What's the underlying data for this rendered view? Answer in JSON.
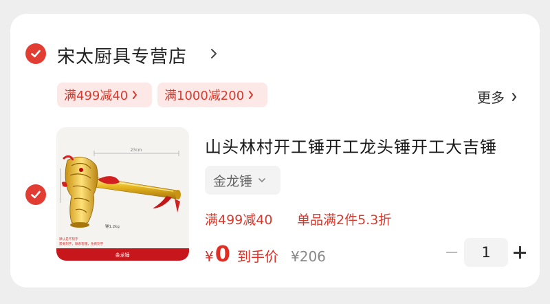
{
  "store": {
    "name": "宋太厨具专营店",
    "chevron_icon": "chevron-right-icon",
    "selected": true
  },
  "promos": [
    {
      "label": "满499减40"
    },
    {
      "label": "满1000减200"
    }
  ],
  "more_label": "更多",
  "item": {
    "selected": true,
    "title": "山头林村开工锤开工龙头锤开工大吉锤",
    "variant": "金龙锤",
    "promo_tags": [
      "满499减40",
      "单品满2件5.3折"
    ],
    "price_symbol": "¥",
    "price_value": "0",
    "price_label": "到手价",
    "original_price": "¥206",
    "quantity": "1",
    "thumbnail": {
      "dimension_label": "23cm",
      "side_label": "10cm",
      "weight_label": "锤1.2kg",
      "note_lines": [
        "默认是不刻字",
        "需要刻字，联系客服，免费刻字"
      ],
      "caption": "金龙锤"
    }
  },
  "colors": {
    "accent_red": "#e23d33",
    "promo_bg": "#fce8e6",
    "promo_text": "#d83a2e",
    "price_red": "#e02e24"
  }
}
